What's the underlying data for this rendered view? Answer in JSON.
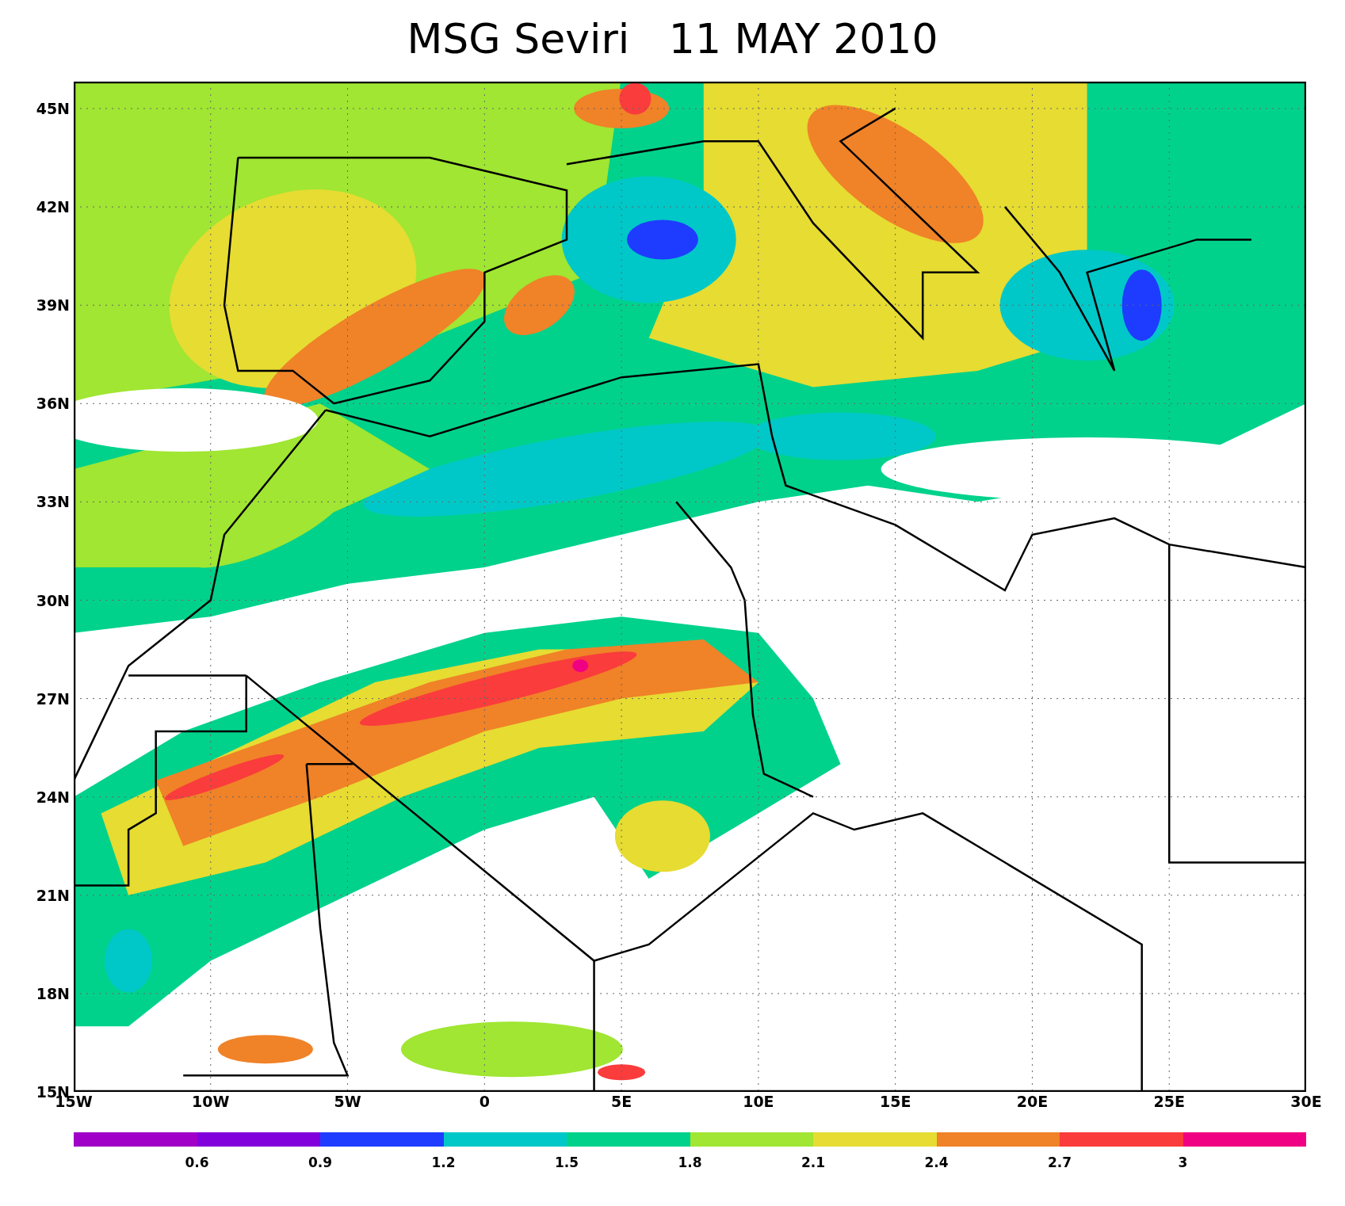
{
  "title": "MSG Seviri   11 MAY 2010",
  "y_axis_labels": [
    "45N",
    "42N",
    "39N",
    "36N",
    "33N",
    "30N",
    "27N",
    "24N",
    "21N",
    "18N",
    "15N"
  ],
  "x_axis_labels": [
    "15W",
    "10W",
    "5W",
    "0",
    "5E",
    "10E",
    "15E",
    "20E",
    "25E",
    "30E"
  ],
  "colorbar": {
    "segments": [
      {
        "color": "#a000c8"
      },
      {
        "color": "#8200dc"
      },
      {
        "color": "#1e3cff"
      },
      {
        "color": "#00c8c8"
      },
      {
        "color": "#00d28c"
      },
      {
        "color": "#a0e632"
      },
      {
        "color": "#e6dc32"
      },
      {
        "color": "#f08228"
      },
      {
        "color": "#fa3c3c"
      },
      {
        "color": "#f00082"
      }
    ],
    "labels": [
      "0.6",
      "0.9",
      "1.2",
      "1.5",
      "1.8",
      "2.1",
      "2.4",
      "2.7",
      "3"
    ]
  }
}
